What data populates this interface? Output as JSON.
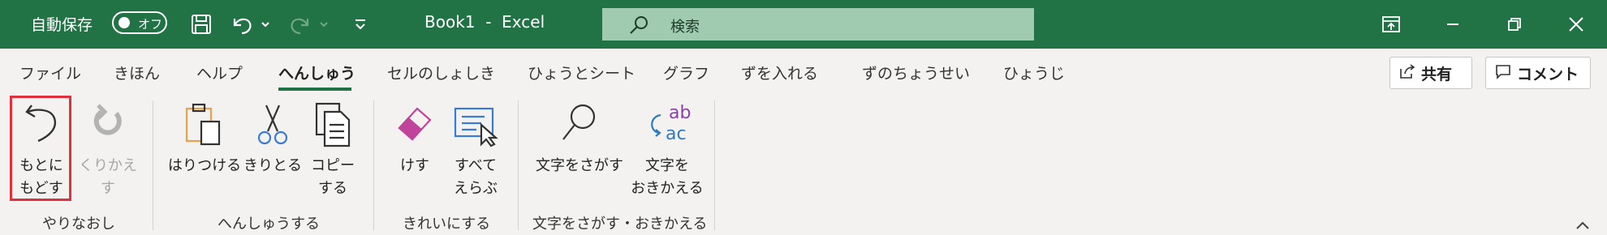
{
  "titlebar": {
    "autosave_label": "自動保存",
    "autosave_state": "オフ",
    "document_title": "Book1  -  Excel",
    "search_placeholder": "検索",
    "icons": [
      "save-icon",
      "undo-icon",
      "redo-icon",
      "customize-qat-icon",
      "ribbon-display-options-icon",
      "minimize-icon",
      "restore-icon",
      "close-icon"
    ]
  },
  "tabs": [
    {
      "label": "ファイル",
      "active": false
    },
    {
      "label": "きほん",
      "active": false
    },
    {
      "label": "ヘルプ",
      "active": false
    },
    {
      "label": "へんしゅう",
      "active": true
    },
    {
      "label": "セルのしょしき",
      "active": false
    },
    {
      "label": "ひょうとシート",
      "active": false
    },
    {
      "label": "グラフ",
      "active": false
    },
    {
      "label": "ずを入れる",
      "active": false
    },
    {
      "label": "ずのちょうせい",
      "active": false
    },
    {
      "label": "ひょうじ",
      "active": false
    }
  ],
  "actions": {
    "share_label": "共有",
    "comment_label": "コメント"
  },
  "ribbon": {
    "undo": {
      "line1": "もとに",
      "line2": "もどす"
    },
    "redo": {
      "line1": "くりかえす"
    },
    "group1_label": "やりなおし",
    "paste": {
      "line1": "はりつける"
    },
    "cut": {
      "line1": "きりとる"
    },
    "copy": {
      "line1": "コピー",
      "line2": "する"
    },
    "group2_label": "へんしゅうする",
    "clear": {
      "line1": "けす"
    },
    "select_all": {
      "line1": "すべて",
      "line2": "えらぶ"
    },
    "group3_label": "きれいにする",
    "find": {
      "line1": "文字をさがす"
    },
    "replace": {
      "line1": "文字を",
      "line2": "おきかえる"
    },
    "group4_label": "文字をさがす・おきかえる"
  },
  "colors": {
    "titlebar": "#217346",
    "search_box": "#a0cbb0",
    "highlight": "#e0303e",
    "clip_orange": "#e8a24a",
    "scissors_blue": "#3a7bd5",
    "eraser_pink": "#c0449a"
  }
}
